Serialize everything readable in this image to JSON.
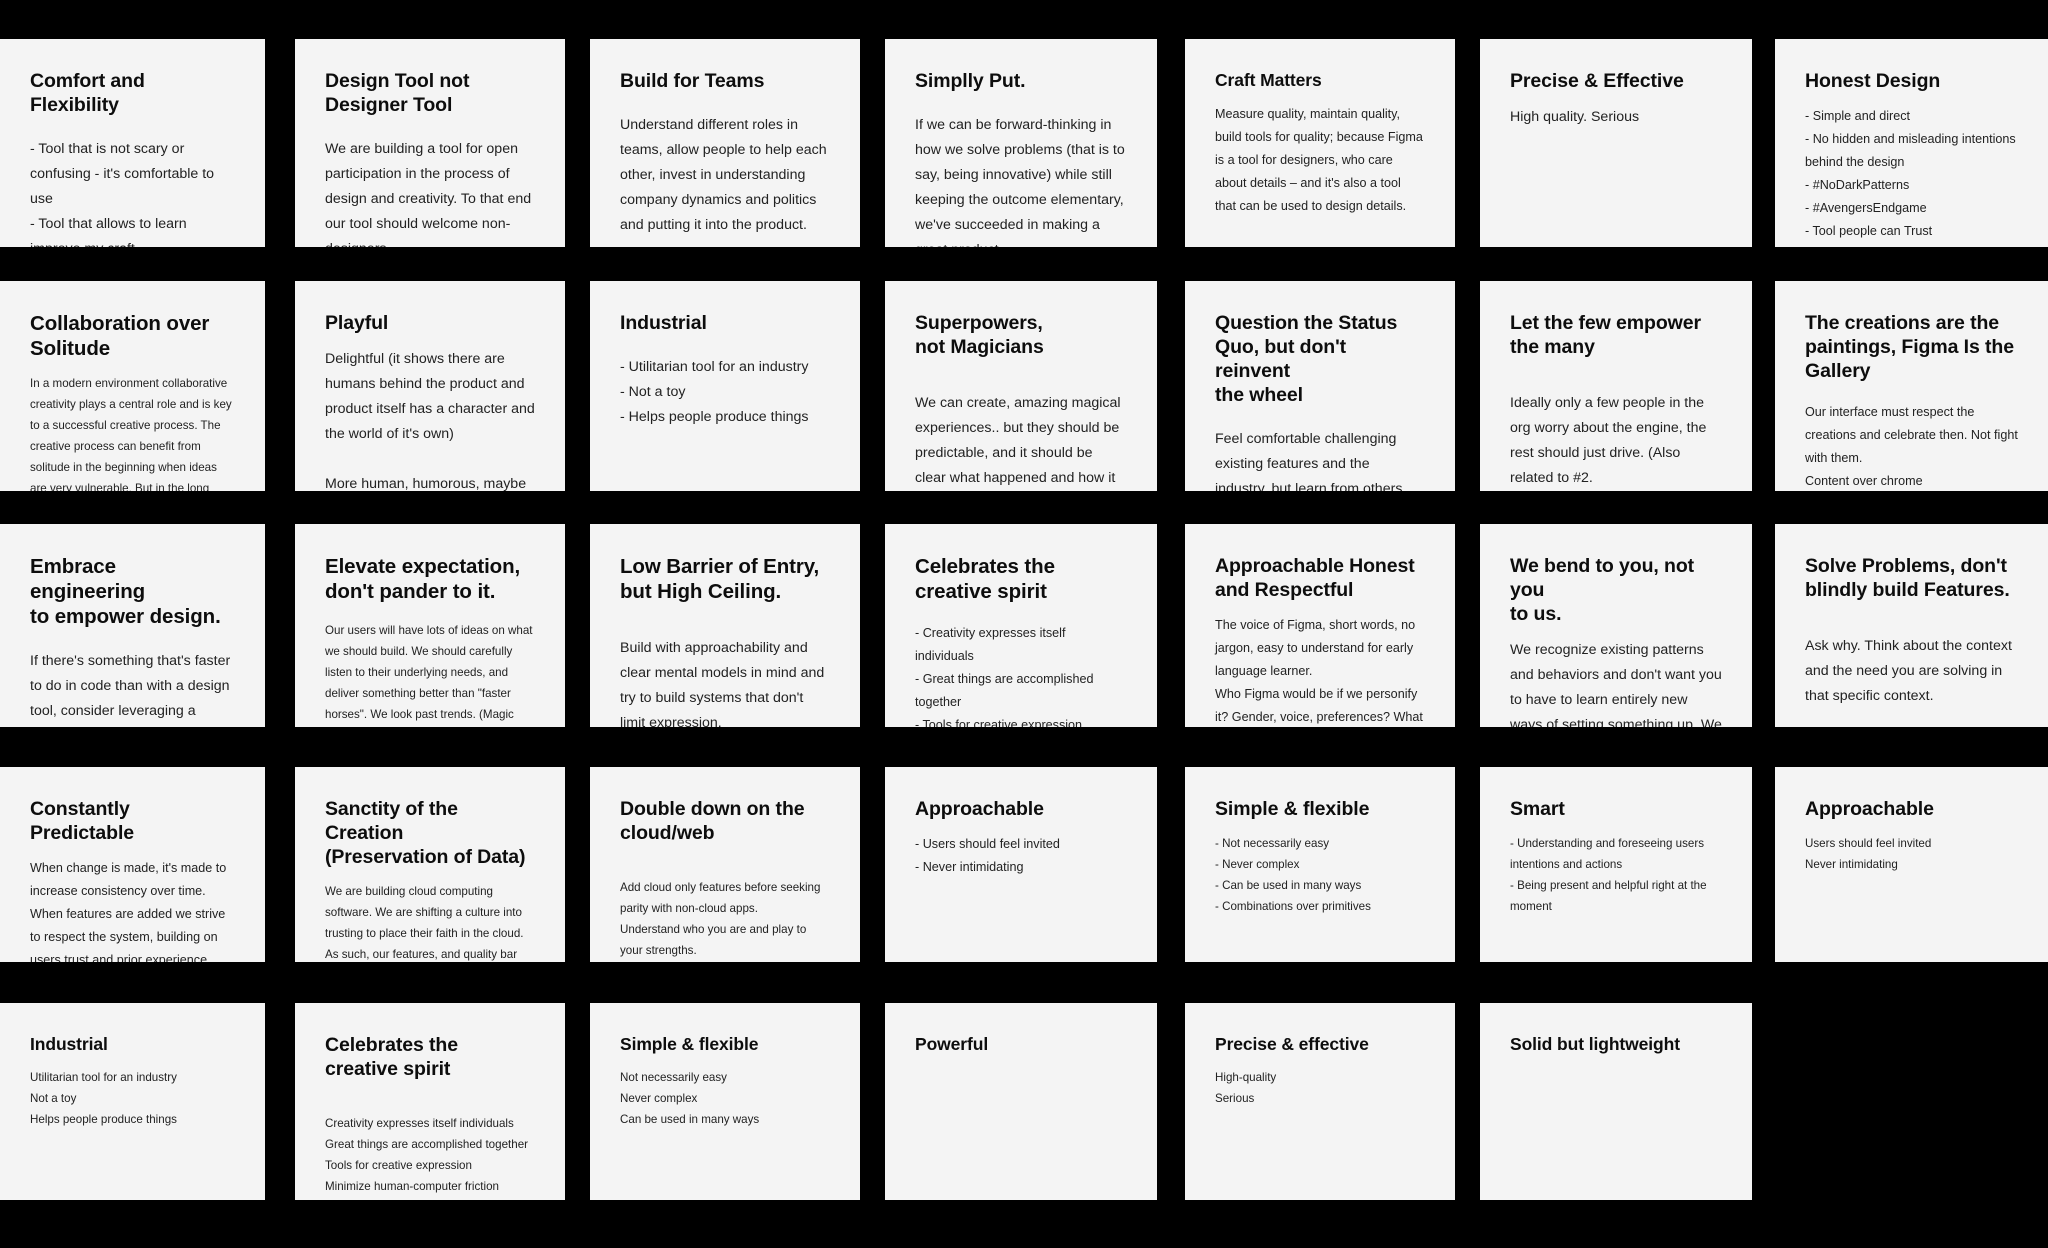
{
  "board": {
    "background_color": "#000000",
    "card_color": "#f4f4f4",
    "title_color": "#0d0d0d",
    "body_color": "#222222"
  },
  "cards": [
    {
      "title": "Comfort and\nFlexibility",
      "body": "- Tool that is not scary or confusing - it's comfortable to use\n- Tool that allows to learn improve my craft\n- It holds my hand and guides me as a user"
    },
    {
      "title": "Design Tool not\nDesigner Tool",
      "body": "We are building a tool for open participation in the process of design and creativity. To that end our tool should welcome non-designers."
    },
    {
      "title": "Build for Teams",
      "body": "Understand different roles in teams, allow people to help each other, invest in understanding company dynamics and politics and putting it into the product."
    },
    {
      "title": "Simplly Put.",
      "body": "If we can be forward-thinking in how we solve problems (that is to say, being innovative) while still keeping the outcome elementary, we've succeeded in making a great product."
    },
    {
      "title": "Craft Matters",
      "body": "Measure quality, maintain quality, build tools for quality; because Figma is a tool for designers, who care about details – and it's also a tool that can be used to design details."
    },
    {
      "title": "Precise & Effective",
      "body": "High quality. Serious"
    },
    {
      "title": "Honest Design",
      "body": " - Simple and direct\n - No hidden and misleading intentions behind the design\n - #NoDarkPatterns\n - #AvengersEndgame\n - Tool people can Trust"
    },
    {
      "title": "Collaboration over\nSolitude",
      "body": "In a modern environment collaborative creativity plays a central role and is key to a successful creative process. The creative process can benefit from solitude in the beginning when ideas are very vulnerable. But in the long term collaboration is a pillar of creativity."
    },
    {
      "title": "Playful",
      "body": "Delightful (it shows there are humans behind the product and product itself has a character and the world of it's own)\n\nMore human, humorous, maybe a little bit charismatic\n\nBuild emotional connection with Users"
    },
    {
      "title": "Industrial",
      "body": " - Utilitarian tool for an industry\n - Not a toy\n - Helps people produce things"
    },
    {
      "title": "Superpowers,\nnot Magicians",
      "body": "We can create, amazing magical experiences.. but they should be predictable, and it should be clear what happened and how it was done."
    },
    {
      "title": "Question the Status\nQuo, but don't reinvent\nthe wheel",
      "body": " Feel comfortable challenging existing features and the industry, but learn from others and don't run in circles."
    },
    {
      "title": "Let the few empower\nthe many",
      "body": " Ideally only a few people in the org worry about the engine, the rest should just drive. (Also related to #2."
    },
    {
      "title": "The creations are the\npaintings, Figma Is the\nGallery",
      "body": " Our interface must respect the creations and celebrate then. Not fight with them.\n Content over chrome"
    },
    {
      "title": "Embrace engineering\nto empower design.",
      "body": "If there's something that's faster to do in code than with a design tool, consider leveraging a system or pattern to speed it up. No more pixel nudging! No redundancies."
    },
    {
      "title": "Elevate expectation,\ndon't pander to it.",
      "body": "Our users will have lots of ideas on what we should build. We should carefully listen to their underlying needs, and deliver something better than \"faster horses\". We look past trends. (Magic selections, styles, etc,.)"
    },
    {
      "title": "Low Barrier of Entry,\nbut High Ceiling.",
      "body": "Build with approachability and clear mental models in mind and try to build systems that don't limit expression."
    },
    {
      "title": "Celebrates the\ncreative spirit",
      "body": "- Creativity expresses itself individuals\n- Great things are accomplished together\n- Tools for creative expression\n- Minimize human-computer friction"
    },
    {
      "title": "Approachable Honest\nand Respectful",
      "body": " The voice of Figma, short words, no jargon, easy to understand for early language learner.\n Who Figma would be if we personify it? Gender, voice, preferences? What the world would be that person lives in?"
    },
    {
      "title": "We bend to you, not you\nto us.",
      "body": "We recognize existing patterns and behaviors and don't want you to have to learn entirely new ways of setting something up. We respect how you've set up your file, and add superpowers to it. (e.g. magic selections, scrolling, etc,.)."
    },
    {
      "title": "Solve Problems, don't\nblindly build Features.",
      "body": "Ask why. Think about the context and the need you are solving in that specific context."
    },
    {
      "title": "Constantly Predictable",
      "body": "When change is made, it's made to increase consistency over time. When features are added we strive to respect the system, building on users trust and prior experience. When we introduce a new pattern, we do so mindfulnessly."
    },
    {
      "title": "Sanctity of the Creation\n(Preservation of Data)",
      "body": "We are building cloud computing software. We are shifting a culture into trusting to place their faith in the cloud. As such, our features, and quality bar should prioritize data preservation and off-line experiences."
    },
    {
      "title": "Double down on the\ncloud/web",
      "body": "Add cloud only features before seeking parity with non-cloud apps.\n Understand who you are and play to your strengths."
    },
    {
      "title": "Approachable",
      "body": "- Users should feel invited\n- Never intimidating"
    },
    {
      "title": "Simple & flexible",
      "body": "- Not necessarily easy\n- Never complex\n- Can be used in many ways\n- Combinations over primitives"
    },
    {
      "title": "Smart",
      "body": "- Understanding and foreseeing users intentions and actions\n- Being present and helpful right at the moment"
    },
    {
      "title": "Approachable",
      "body": "Users should feel invited\nNever intimidating"
    },
    {
      "title": "Industrial",
      "body": "Utilitarian tool for an industry\nNot a toy\nHelps people produce things"
    },
    {
      "title": "Celebrates the\ncreative spirit",
      "body": "Creativity expresses itself individuals\nGreat things are accomplished together\nTools for creative expression\nMinimize human-computer friction"
    },
    {
      "title": "Simple & flexible",
      "body": "Not necessarily easy\nNever complex\nCan be used in many ways"
    },
    {
      "title": "Powerful",
      "body": ""
    },
    {
      "title": "Precise & effective",
      "body": "High-quality\nSerious"
    },
    {
      "title": "Solid but lightweight",
      "body": ""
    }
  ]
}
